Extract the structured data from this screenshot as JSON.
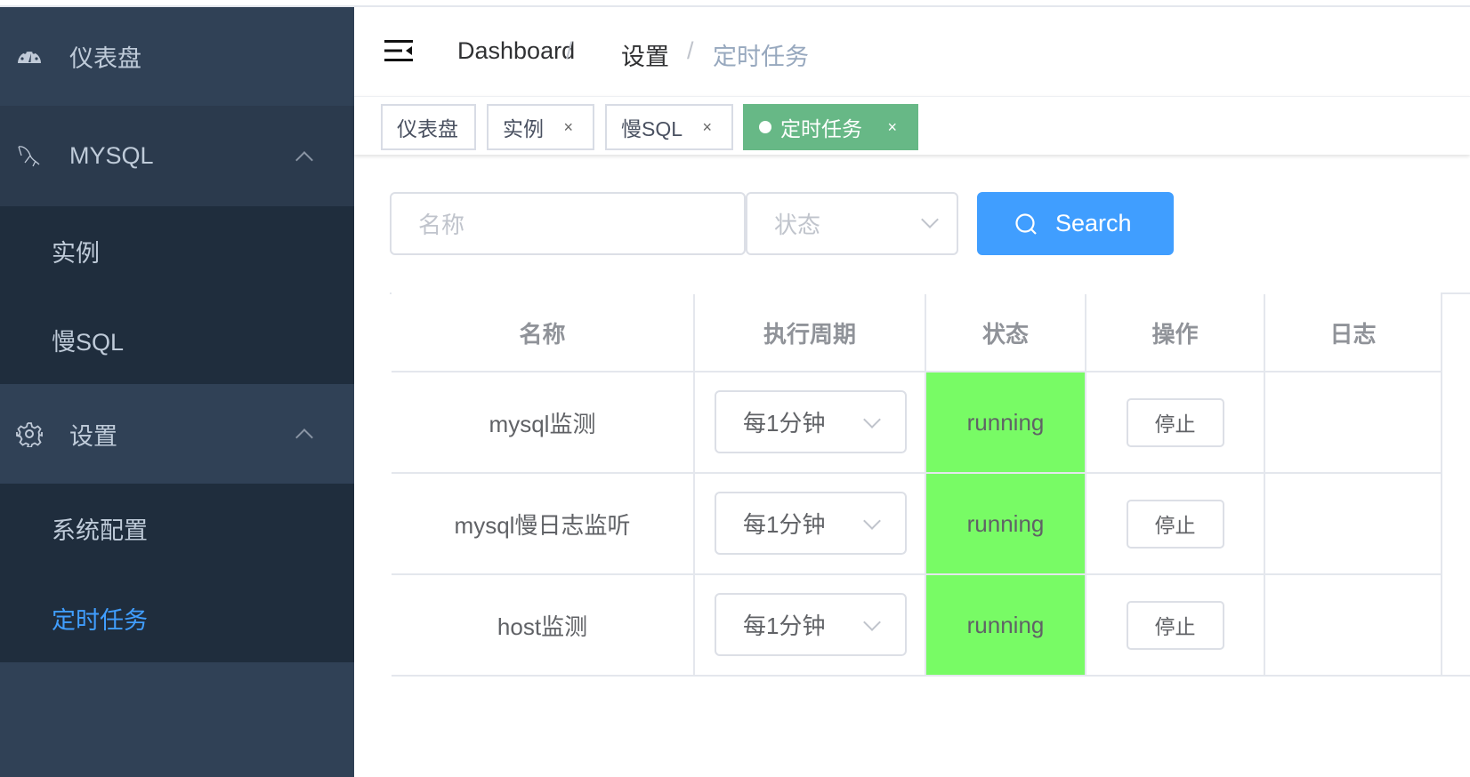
{
  "sidebar": {
    "items": [
      {
        "label": "仪表盘",
        "icon": "dashboard-icon"
      },
      {
        "label": "MYSQL",
        "icon": "mysql-dolphin-icon"
      },
      {
        "label": "实例"
      },
      {
        "label": "慢SQL"
      },
      {
        "label": "设置",
        "icon": "gear-icon"
      },
      {
        "label": "系统配置"
      },
      {
        "label": "定时任务",
        "active": true
      }
    ]
  },
  "header": {
    "breadcrumb": [
      "Dashboard",
      "设置",
      "定时任务"
    ],
    "separator": "/"
  },
  "tabs": [
    {
      "label": "仪表盘"
    },
    {
      "label": "实例",
      "close": "×"
    },
    {
      "label": "慢SQL",
      "close": "×"
    },
    {
      "label": "定时任务",
      "close": "×",
      "active": true
    }
  ],
  "filters": {
    "name_placeholder": "名称",
    "status_placeholder": "状态",
    "search_label": "Search"
  },
  "table": {
    "columns": [
      "名称",
      "执行周期",
      "状态",
      "操作",
      "日志"
    ],
    "rows": [
      {
        "name": "mysql监测",
        "period": "每1分钟",
        "status": "running",
        "action": "停止",
        "log": ""
      },
      {
        "name": "mysql慢日志监听",
        "period": "每1分钟",
        "status": "running",
        "action": "停止",
        "log": ""
      },
      {
        "name": "host监测",
        "period": "每1分钟",
        "status": "running",
        "action": "停止",
        "log": ""
      }
    ]
  },
  "colors": {
    "sidebar": "#304156",
    "submenu": "#1f2d3d",
    "accent": "#409eff",
    "active_tab": "#67b886",
    "running": "#78fb65"
  }
}
